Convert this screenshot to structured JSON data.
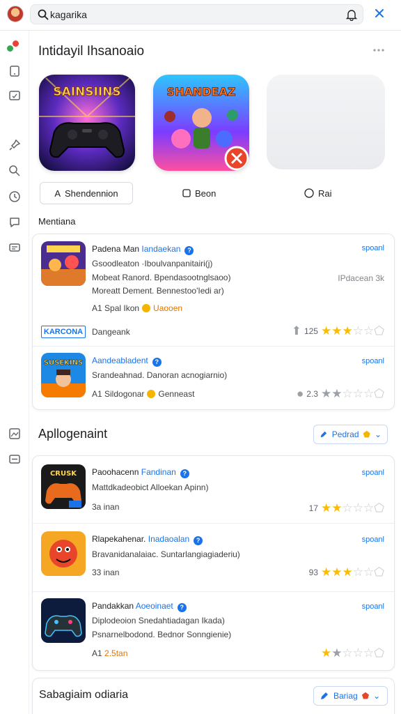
{
  "search": {
    "value": "kagarika",
    "placeholder": ""
  },
  "section1": {
    "title": "Intidayil Ihsanoaio",
    "chips": [
      {
        "label": "Shendennion",
        "prefix": "A"
      },
      {
        "label": "Beon"
      },
      {
        "label": "Rai"
      }
    ],
    "sub_label": "Mentiana"
  },
  "tiles": [
    {
      "art_text": "SAINSIINS"
    },
    {
      "art_text": "SHANDEAZ"
    }
  ],
  "card1": {
    "items": [
      {
        "title": "Padena Man",
        "title_accent": "Iandaekan",
        "tag": "spoanl",
        "lines": [
          "Gsoodleaton ·Iboulvanpanitairi(j)",
          "Mobeat Ranord. Bpendasootnglsaoo)",
          "Moreatt Dement. Bennestoo'Iedi ar)"
        ],
        "note": "IPdacean 3k",
        "meta_prefix": "A1 Spal Ikon",
        "meta_accent": "Uaooen",
        "brand_badge": "KARCONA",
        "brand_text": "Dangeank",
        "rating_count": "125",
        "rating": 3
      },
      {
        "title": "",
        "title_accent": "Aandeabladent",
        "tag": "spoanl",
        "lines": [
          "Srandeahnad. Danoran acnogiarnio)"
        ],
        "meta_prefix": "A1 Sildogonar",
        "meta_accent": "Genneast",
        "rating_count": "2.3",
        "rating": 0,
        "thumb_text": "SUSEKINS"
      }
    ]
  },
  "section2": {
    "title": "Apllogenaint",
    "pill_label": "Pedrad",
    "items": [
      {
        "title": "Paoohacenn",
        "title_accent": "Fandinan",
        "tag": "spoanl",
        "lines": [
          "Mattdkadeobict Alloekan Apinn)"
        ],
        "meta": "3a inan",
        "rating_count": "17",
        "rating": 2,
        "thumb_text": "CRUSK"
      },
      {
        "title": "Rlapekahenar.",
        "title_accent": "Inadaoalan",
        "tag": "spoanl",
        "lines": [
          "Bravanidanalaiac. Suntarlangiagiaderiu)"
        ],
        "meta": "33 inan",
        "rating_count": "93",
        "rating": 3
      },
      {
        "title": "Pandakkan",
        "title_accent": "Aoeoinaet",
        "tag": "spoanl",
        "lines": [
          "Diplodeoion Snedahtiadagan Ikada)",
          "Psnarnelbodond. Bednor Sonngienie)"
        ],
        "meta_prefix": "A1",
        "meta_accent": "2.5tan",
        "rating": 1
      }
    ]
  },
  "section3": {
    "title": "Sabagiaim odiaria",
    "pill_label": "Bariag"
  },
  "colors": {
    "accent": "#1a73e8",
    "star": "#fbbc04",
    "coin": "#f4b400",
    "orange": "#e37400"
  },
  "icons": {
    "sidebar": [
      "tablet-icon",
      "monitor-icon",
      "pin-icon",
      "search-person-icon",
      "clock-icon",
      "chat-icon",
      "message-icon",
      "image-icon",
      "comment-icon"
    ]
  }
}
